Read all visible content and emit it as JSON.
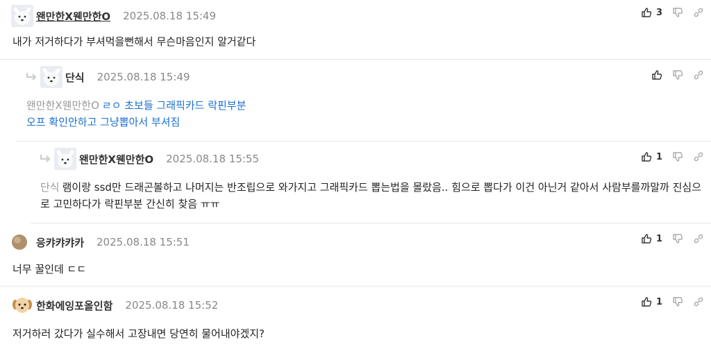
{
  "comments": [
    {
      "nickname": "왠만한X웬만한O",
      "date": "2025.08.18 15:49",
      "text": "내가 저거하다가 부셔먹을뻔해서 무슨마음인지 알거같다",
      "likes": "3"
    },
    {
      "nickname": "단식",
      "date": "2025.08.18 15:49",
      "mention": "왠만한X웬만한O",
      "line1": "ㄹㅇ 초보들 그래픽카드 락핀부분",
      "line2": "오프 확인안하고 그냥뽑아서 부셔짐",
      "likes": ""
    },
    {
      "nickname": "왠만한X웬만한O",
      "date": "2025.08.18 15:55",
      "mention": "단식",
      "text": "램이랑 ssd만 드래곤볼하고 나머지는 반조립으로 와가지고 그래픽카드 뽑는법을 몰랐음.. 힘으로 뽑다가 이건 아닌거 같아서 사람부를까말까 진심으로 고민하다가 락핀부분 간신히 찾음 ㅠㅠ",
      "likes": "1"
    },
    {
      "nickname": "응캬캬캬카",
      "date": "2025.08.18 15:51",
      "text": "너무 꿀인데 ㄷㄷ",
      "likes": "1"
    },
    {
      "nickname": "한화에잉포올인함",
      "date": "2025.08.18 15:52",
      "text": "저거하러 갔다가 실수해서 고장내면 당연히 물어내야겠지?",
      "likes": "1"
    }
  ],
  "icons": {
    "like": "thumbs-up-icon",
    "dislike": "thumbs-down-icon",
    "link": "link-icon",
    "reply": "reply-arrow-icon"
  },
  "colors": {
    "mention_blue": "#1a6fd1"
  }
}
